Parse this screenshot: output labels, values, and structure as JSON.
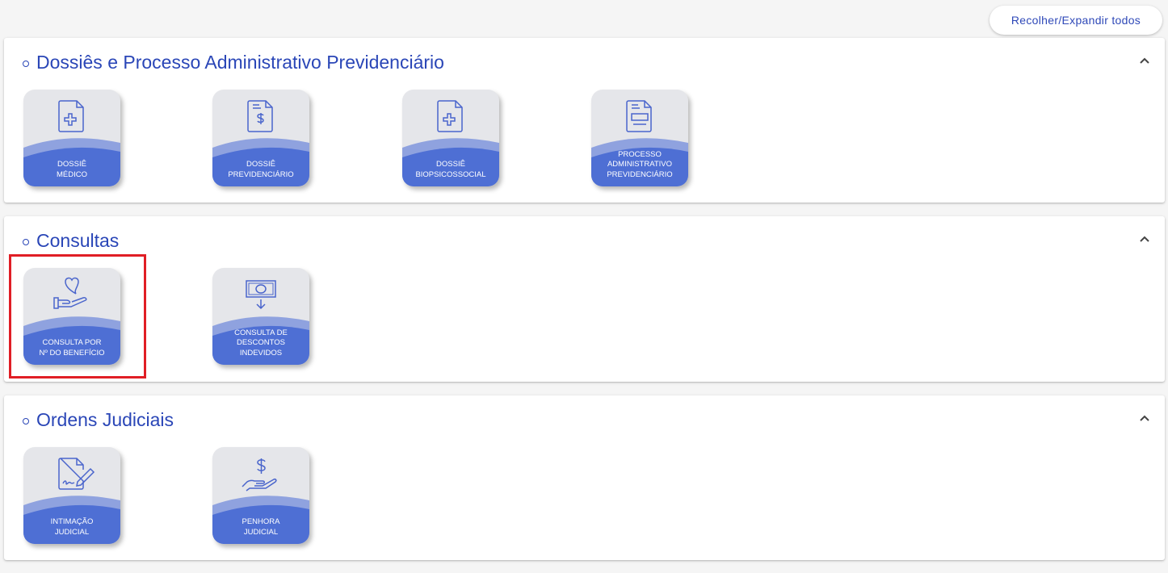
{
  "toolbar": {
    "toggle_all_label": "Recolher/Expandir todos"
  },
  "colors": {
    "accent": "#2a46b7",
    "tile_bg": "#e5e6ea",
    "wave": "#4e6fd4",
    "highlight": "#e01e25"
  },
  "sections": [
    {
      "title": "Dossiês e Processo Administrativo Previdenciário",
      "tiles": [
        {
          "label": "DOSSIÊ\nMÉDICO",
          "icon": "medical-document-icon"
        },
        {
          "label": "DOSSIÊ\nPREVIDENCIÁRIO",
          "icon": "money-document-icon"
        },
        {
          "label": "DOSSIÊ\nBIOPSICOSSOCIAL",
          "icon": "medical-document-icon"
        },
        {
          "label": "PROCESSO\nADMINISTRATIVO\nPREVIDENCIÁRIO",
          "icon": "form-document-icon"
        }
      ]
    },
    {
      "title": "Consultas",
      "tiles": [
        {
          "label": "CONSULTA POR\nNº DO BENEFÍCIO",
          "icon": "heart-hand-icon"
        },
        {
          "label": "CONSULTA DE\nDESCONTOS\nINDEVIDOS",
          "icon": "banknote-arrow-icon"
        }
      ]
    },
    {
      "title": "Ordens Judiciais",
      "tiles": [
        {
          "label": "INTIMAÇÃO\nJUDICIAL",
          "icon": "signed-document-icon"
        },
        {
          "label": "PENHORA\nJUDICIAL",
          "icon": "money-hand-icon"
        }
      ]
    }
  ]
}
